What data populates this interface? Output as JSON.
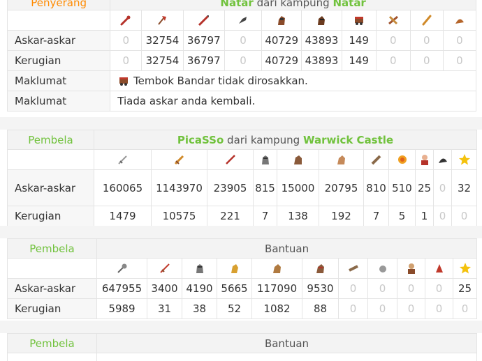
{
  "attacker": {
    "role": "Penyerang",
    "player": "Natar",
    "from_word": "dari kampung",
    "village": "Natar",
    "units": [
      "club",
      "axe",
      "spear",
      "scout",
      "paladin",
      "teutonic-knight",
      "ram",
      "catapult",
      "chief",
      "settler"
    ],
    "rows": [
      {
        "label": "Askar-askar",
        "values": [
          "0",
          "32754",
          "36797",
          "0",
          "40729",
          "43893",
          "149",
          "0",
          "0",
          "0"
        ]
      },
      {
        "label": "Kerugian",
        "values": [
          "0",
          "32754",
          "36797",
          "0",
          "40729",
          "43893",
          "149",
          "0",
          "0",
          "0"
        ]
      }
    ],
    "info": [
      {
        "label": "Maklumat",
        "text": "Tembok Bandar tidak dirosakkan.",
        "icon": "ram-icon"
      },
      {
        "label": "Maklumat",
        "text": "Tiada askar anda kembali."
      }
    ]
  },
  "defender1": {
    "role": "Pembela",
    "player": "PicaSSo",
    "from_word": "dari kampung",
    "village": "Warwick Castle",
    "units": [
      "legionnaire",
      "praetorian",
      "imperian",
      "equites-legati",
      "equites-imperatoris",
      "equites-caesaris",
      "battering-ram",
      "fire-catapult",
      "senator",
      "settler",
      "hero"
    ],
    "rows": [
      {
        "label": "Askar-askar",
        "values": [
          "160065",
          "1143970",
          "23905",
          "815",
          "15000",
          "20795",
          "810",
          "510",
          "25",
          "0",
          "32"
        ]
      },
      {
        "label": "Kerugian",
        "values": [
          "1479",
          "10575",
          "221",
          "7",
          "138",
          "192",
          "7",
          "5",
          "1",
          "0",
          "0"
        ]
      }
    ]
  },
  "defender2": {
    "role": "Pembela",
    "title": "Bantuan",
    "units": [
      "mace",
      "sword",
      "helmet",
      "horse-head",
      "horse",
      "knight",
      "ram",
      "catapult",
      "chief",
      "settler",
      "hero"
    ],
    "rows": [
      {
        "label": "Askar-askar",
        "values": [
          "647955",
          "3400",
          "4190",
          "5665",
          "117090",
          "9530",
          "0",
          "0",
          "0",
          "0",
          "25"
        ]
      },
      {
        "label": "Kerugian",
        "values": [
          "5989",
          "31",
          "38",
          "52",
          "1082",
          "88",
          "0",
          "0",
          "0",
          "0",
          "0"
        ]
      }
    ]
  },
  "defender3": {
    "role": "Pembela",
    "title": "Bantuan"
  },
  "colors": {
    "attacker": "#ff8a00",
    "defender": "#71c23d",
    "zero": "#c8c8c8"
  }
}
